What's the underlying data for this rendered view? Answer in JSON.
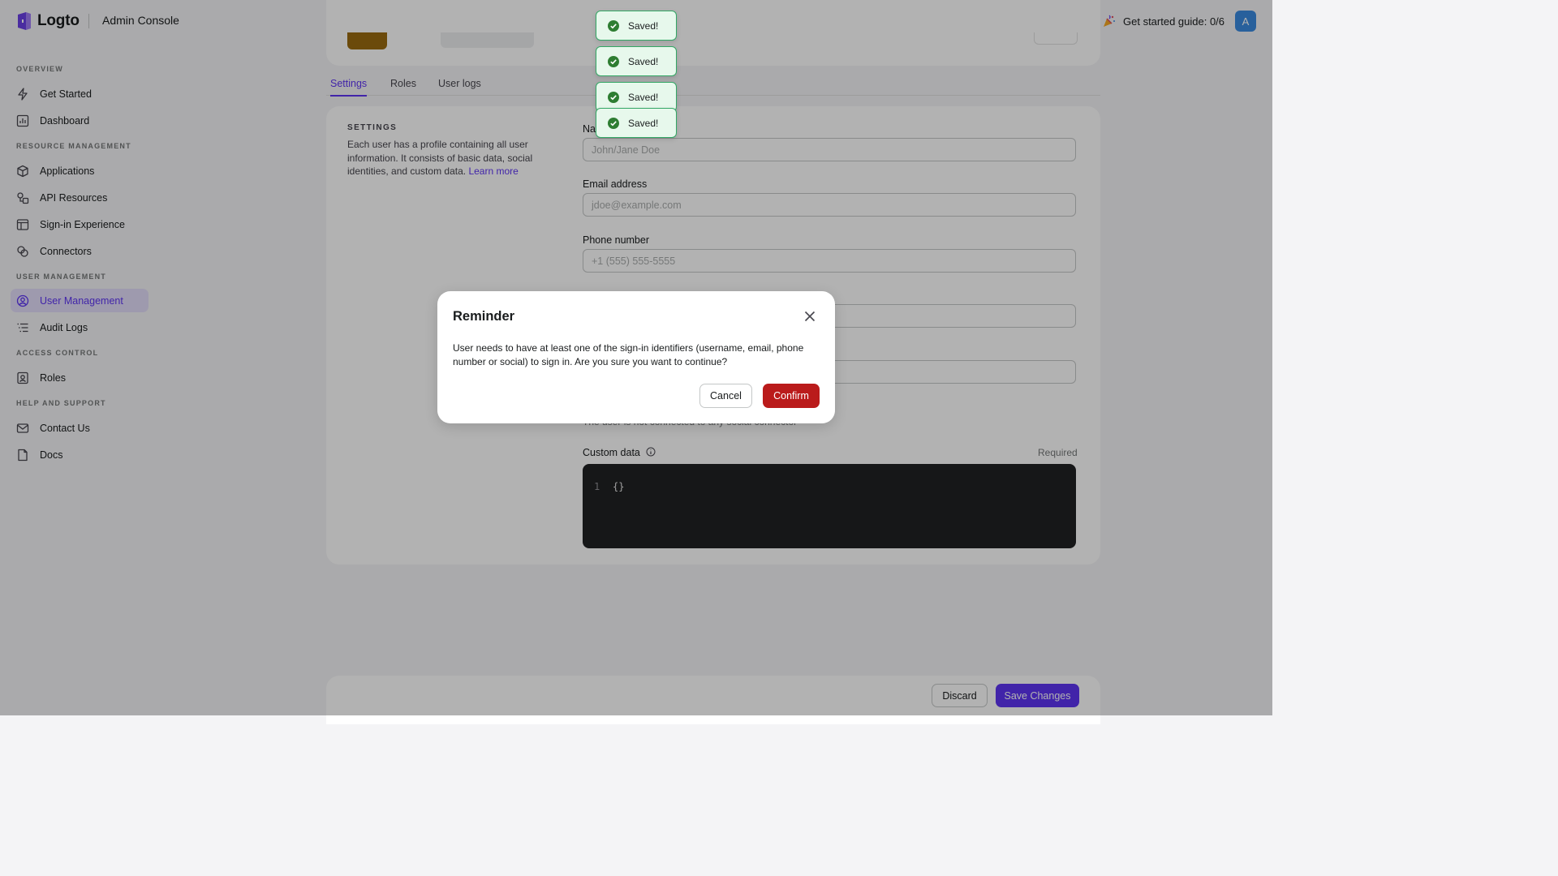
{
  "header": {
    "logo_text": "Logto",
    "app_title": "Admin Console",
    "guide_label": "Get started guide: 0/6",
    "avatar_letter": "A"
  },
  "sidebar": {
    "sections": {
      "overview": "OVERVIEW",
      "resource": "RESOURCE MANAGEMENT",
      "user": "USER MANAGEMENT",
      "access": "ACCESS CONTROL",
      "help": "HELP AND SUPPORT"
    },
    "items": {
      "get_started": "Get Started",
      "dashboard": "Dashboard",
      "applications": "Applications",
      "api_resources": "API Resources",
      "sign_in_experience": "Sign-in Experience",
      "connectors": "Connectors",
      "user_management": "User Management",
      "audit_logs": "Audit Logs",
      "roles": "Roles",
      "contact_us": "Contact Us",
      "docs": "Docs"
    },
    "active_item": "User Management"
  },
  "tabs": [
    "Settings",
    "Roles",
    "User logs"
  ],
  "settings": {
    "section_title": "SETTINGS",
    "description": "Each user has a profile containing all user information. It consists of basic data, social identities, and custom data.",
    "learn_more": "Learn more",
    "name_label": "Na",
    "name_placeholder": "John/Jane Doe",
    "email_label": "Email address",
    "email_placeholder": "jdoe@example.com",
    "phone_label": "Phone number",
    "phone_placeholder": "+1 (555) 555-5555",
    "social_note": "The user is not connected to any social connector",
    "custom_data_label": "Custom data",
    "required_label": "Required",
    "editor_line_number": "1",
    "editor_content": "{}"
  },
  "footer": {
    "discard": "Discard",
    "save": "Save Changes"
  },
  "toasts": [
    "Saved!",
    "Saved!",
    "Saved!",
    "Saved!"
  ],
  "modal": {
    "title": "Reminder",
    "body": "User needs to have at least one of the sign-in identifiers (username, email, phone number or social) to sign in. Are you sure you want to continue?",
    "cancel": "Cancel",
    "confirm": "Confirm"
  },
  "colors": {
    "accent": "#5d34f2",
    "danger": "#ba1b1b",
    "success": "#33a765",
    "avatar": "#3a8ae0"
  },
  "icons": {
    "logo": "logto-logo-icon",
    "guide": "party-popper-icon",
    "toast": "check-circle-icon",
    "close": "close-icon",
    "info": "info-icon"
  }
}
